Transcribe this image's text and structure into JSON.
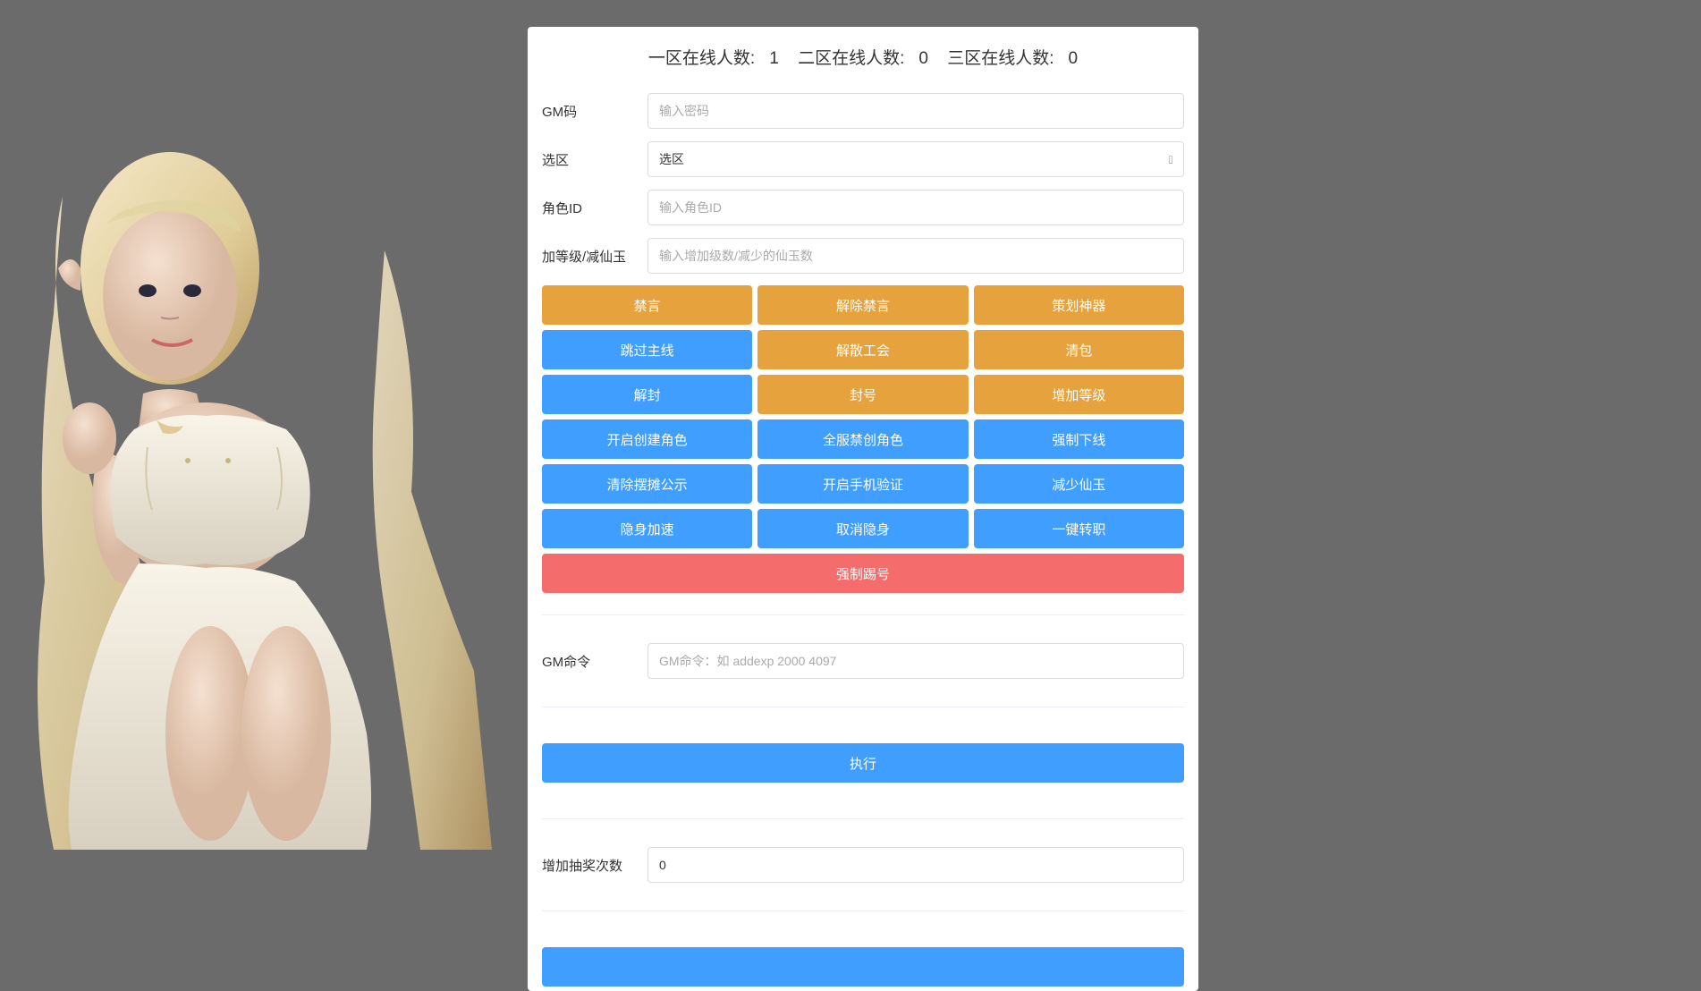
{
  "stats": {
    "zone1_label": "一区在线人数:",
    "zone1_count": "1",
    "zone2_label": "二区在线人数:",
    "zone2_count": "0",
    "zone3_label": "三区在线人数:",
    "zone3_count": "0"
  },
  "form": {
    "gm_code_label": "GM码",
    "gm_code_placeholder": "输入密码",
    "zone_label": "选区",
    "zone_selected": "选区",
    "role_id_label": "角色ID",
    "role_id_placeholder": "输入角色ID",
    "level_jade_label": "加等级/减仙玉",
    "level_jade_placeholder": "输入增加级数/减少的仙玉数"
  },
  "buttons": {
    "r1c1": "禁言",
    "r1c2": "解除禁言",
    "r1c3": "策划神器",
    "r2c1": "跳过主线",
    "r2c2": "解散工会",
    "r2c3": "清包",
    "r3c1": "解封",
    "r3c2": "封号",
    "r3c3": "增加等级",
    "r4c1": "开启创建角色",
    "r4c2": "全服禁创角色",
    "r4c3": "强制下线",
    "r5c1": "清除摆摊公示",
    "r5c2": "开启手机验证",
    "r5c3": "减少仙玉",
    "r6c1": "隐身加速",
    "r6c2": "取消隐身",
    "r6c3": "一键转职",
    "r7": "强制踢号"
  },
  "cmd": {
    "label": "GM命令",
    "placeholder": "GM命令：如 addexp 2000 4097",
    "exec_label": "执行"
  },
  "lottery": {
    "label": "增加抽奖次数",
    "value": "0"
  }
}
